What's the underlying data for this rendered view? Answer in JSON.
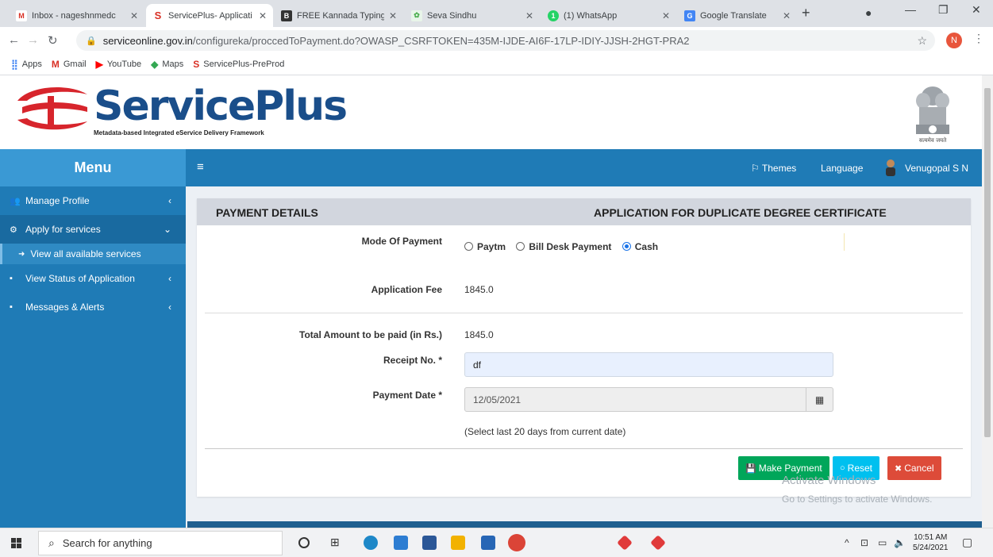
{
  "browser": {
    "tabs": [
      {
        "title": "Inbox - nageshnmedc",
        "favicon": "gmail-icon",
        "color": "#d93025"
      },
      {
        "title": "ServicePlus- Applicati",
        "favicon": "serviceplus-icon",
        "color": "#d93025"
      },
      {
        "title": "FREE Kannada Typing |",
        "favicon": "typing-icon",
        "color": "#333333"
      },
      {
        "title": "Seva Sindhu",
        "favicon": "seva-icon",
        "color": "#4caf50"
      },
      {
        "title": "(1) WhatsApp",
        "favicon": "whatsapp-icon",
        "color": "#25d366"
      },
      {
        "title": "Google Translate",
        "favicon": "translate-icon",
        "color": "#4285f4"
      }
    ],
    "url_host": "serviceonline.gov.in",
    "url_path": "/configureka/proccedToPayment.do?OWASP_CSRFTOKEN=435M-IJDE-AI6F-17LP-IDIY-JJSH-2HGT-PRA2",
    "profile_initial": "N",
    "bookmarks": [
      {
        "label": "Apps",
        "icon": "apps-grid-icon",
        "color": "#4285f4"
      },
      {
        "label": "Gmail",
        "icon": "gmail-icon",
        "color": "#d93025"
      },
      {
        "label": "YouTube",
        "icon": "youtube-icon",
        "color": "#ff0000"
      },
      {
        "label": "Maps",
        "icon": "maps-icon",
        "color": "#34a853"
      },
      {
        "label": "ServicePlus-PreProd",
        "icon": "serviceplus-icon",
        "color": "#d93025"
      }
    ]
  },
  "header": {
    "logo_text": "ServicePlus",
    "logo_subtitle": "Metadata-based Integrated eService Delivery Framework",
    "emblem_caption": "सत्यमेव जयते"
  },
  "sidebar": {
    "menu_title": "Menu",
    "items": [
      {
        "label": "Manage Profile",
        "icon": "users-icon"
      },
      {
        "label": "Apply for services",
        "icon": "gears-icon"
      },
      {
        "label": "View all available services",
        "icon": "arrow-circle-icon"
      },
      {
        "label": "View Status of Application",
        "icon": "card-icon"
      },
      {
        "label": "Messages & Alerts",
        "icon": "card-icon"
      }
    ]
  },
  "topnav": {
    "themes": "Themes",
    "language": "Language",
    "user": "Venugopal S N"
  },
  "panel": {
    "left_title": "PAYMENT DETAILS",
    "right_title": "APPLICATION FOR DUPLICATE DEGREE CERTIFICATE",
    "mode_label": "Mode Of Payment",
    "mode_options": [
      "Paytm",
      "Bill Desk Payment",
      "Cash"
    ],
    "mode_selected": "Cash",
    "fee_label": "Application Fee",
    "fee_value": "1845.0",
    "total_label": "Total Amount to be paid (in Rs.)",
    "total_value": "1845.0",
    "receipt_label": "Receipt No. *",
    "receipt_value": "df",
    "date_label": "Payment Date *",
    "date_value": "12/05/2021",
    "date_hint": "(Select last 20 days from current date)",
    "buttons": {
      "make_payment": "Make Payment",
      "reset": "Reset",
      "cancel": "Cancel"
    },
    "button_colors": {
      "make_payment": "#00a65a",
      "reset": "#00c0ef",
      "cancel": "#dd4b39"
    }
  },
  "watermark": {
    "line1": "Activate Windows",
    "line2": "Go to Settings to activate Windows."
  },
  "taskbar": {
    "search_placeholder": "Search for anything",
    "time": "10:51 AM",
    "date": "5/24/2021"
  }
}
